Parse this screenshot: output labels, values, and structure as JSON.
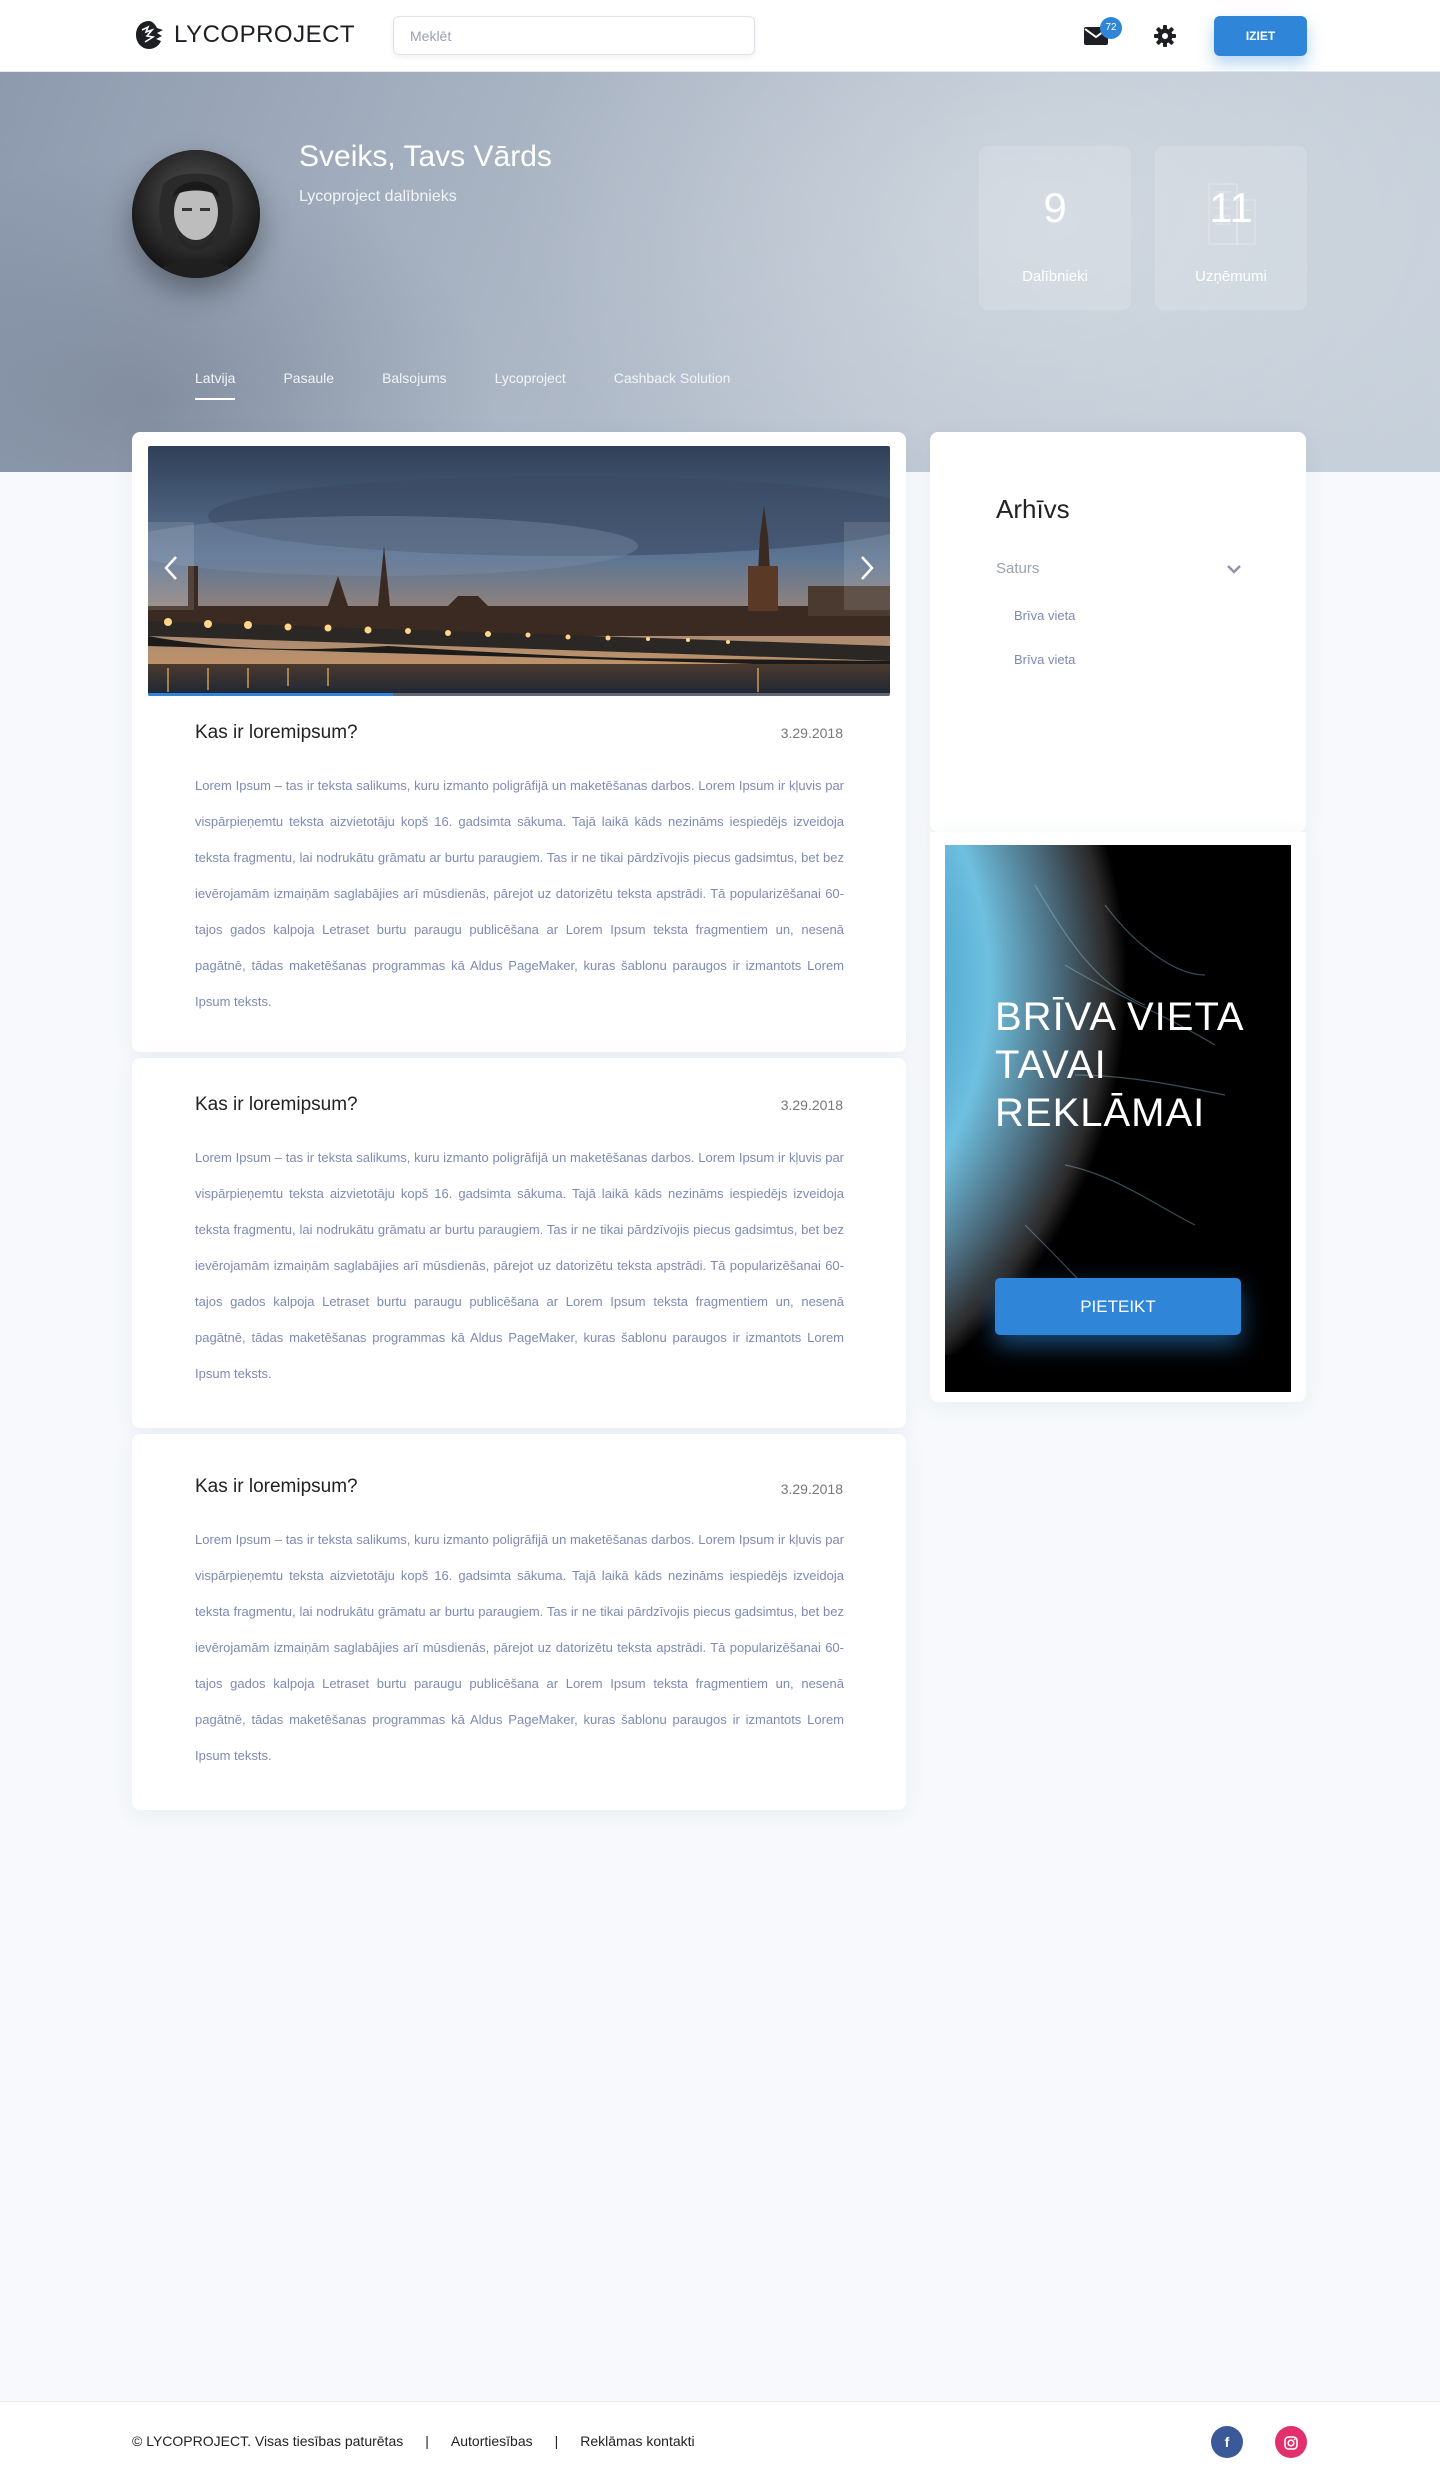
{
  "header": {
    "logo_text": "LYCOPROJECT",
    "search_placeholder": "Meklēt",
    "mail_badge": "72",
    "logout_label": "IZIET"
  },
  "hero": {
    "greeting": "Sveiks, Tavs Vārds",
    "subtitle": "Lycoproject dalībnieks",
    "stats": [
      {
        "value": "9",
        "label": "Dalībnieki"
      },
      {
        "value": "11",
        "label": "Uzņēmumi"
      }
    ],
    "tabs": [
      "Latvija",
      "Pasaule",
      "Balsojums",
      "Lycoproject",
      "Cashback Solution"
    ],
    "active_tab": "Latvija"
  },
  "slider": {
    "prev_icon": "chevron-left-icon",
    "next_icon": "chevron-right-icon",
    "progress": 0.33
  },
  "posts": [
    {
      "title": "Kas ir loremipsum?",
      "date": "3.29.2018",
      "body": "Lorem Ipsum – tas ir teksta salikums, kuru izmanto poligrāfijā un maketēšanas darbos. Lorem Ipsum ir kļuvis par vispārpieņemtu teksta aizvietotāju kopš 16. gadsimta sākuma. Tajā laikā kāds nezināms iespiedējs izveidoja teksta fragmentu, lai nodrukātu grāmatu ar burtu paraugiem. Tas ir ne tikai pārdzīvojis piecus gadsimtus, bet bez ievērojamām izmaiņām saglabājies arī mūsdienās, pārejot uz datorizētu teksta apstrādi. Tā popularizēšanai 60-tajos gados kalpoja Letraset burtu paraugu publicēšana ar Lorem Ipsum teksta fragmentiem un, nesenā pagātnē, tādas maketēšanas programmas kā Aldus PageMaker, kuras šablonu paraugos ir izmantots Lorem Ipsum teksts."
    },
    {
      "title": "Kas ir loremipsum?",
      "date": "3.29.2018",
      "body": "Lorem Ipsum – tas ir teksta salikums, kuru izmanto poligrāfijā un maketēšanas darbos. Lorem Ipsum ir kļuvis par vispārpieņemtu teksta aizvietotāju kopš 16. gadsimta sākuma. Tajā laikā kāds nezināms iespiedējs izveidoja teksta fragmentu, lai nodrukātu grāmatu ar burtu paraugiem. Tas ir ne tikai pārdzīvojis piecus gadsimtus, bet bez ievērojamām izmaiņām saglabājies arī mūsdienās, pārejot uz datorizētu teksta apstrādi. Tā popularizēšanai 60-tajos gados kalpoja Letraset burtu paraugu publicēšana ar Lorem Ipsum teksta fragmentiem un, nesenā pagātnē, tādas maketēšanas programmas kā Aldus PageMaker, kuras šablonu paraugos ir izmantots Lorem Ipsum teksts."
    },
    {
      "title": "Kas ir loremipsum?",
      "date": "3.29.2018",
      "body": "Lorem Ipsum – tas ir teksta salikums, kuru izmanto poligrāfijā un maketēšanas darbos. Lorem Ipsum ir kļuvis par vispārpieņemtu teksta aizvietotāju kopš 16. gadsimta sākuma. Tajā laikā kāds nezināms iespiedējs izveidoja teksta fragmentu, lai nodrukātu grāmatu ar burtu paraugiem. Tas ir ne tikai pārdzīvojis piecus gadsimtus, bet bez ievērojamām izmaiņām saglabājies arī mūsdienās, pārejot uz datorizētu teksta apstrādi. Tā popularizēšanai 60-tajos gados kalpoja Letraset burtu paraugu publicēšana ar Lorem Ipsum teksta fragmentiem un, nesenā pagātnē, tādas maketēšanas programmas kā Aldus PageMaker, kuras šablonu paraugos ir izmantots Lorem Ipsum teksts."
    }
  ],
  "archive": {
    "title": "Arhīvs",
    "group_label": "Saturs",
    "items": [
      "Brīva vieta",
      "Brīva vieta"
    ]
  },
  "ad": {
    "text": "BRĪVA VIETA TAVAI REKLĀMAI",
    "button_label": "PIETEIKT"
  },
  "footer": {
    "copyright": "© LYCOPROJECT. Visas tiesības paturētas",
    "separator": "|",
    "links": [
      "Autortiesības",
      "Reklāmas kontakti"
    ],
    "social": [
      "facebook-icon",
      "instagram-icon"
    ]
  },
  "colors": {
    "accent": "#2f86d8",
    "facebook": "#3b5998",
    "instagram": "#e1306c",
    "body_text": "#7d8ab3"
  }
}
